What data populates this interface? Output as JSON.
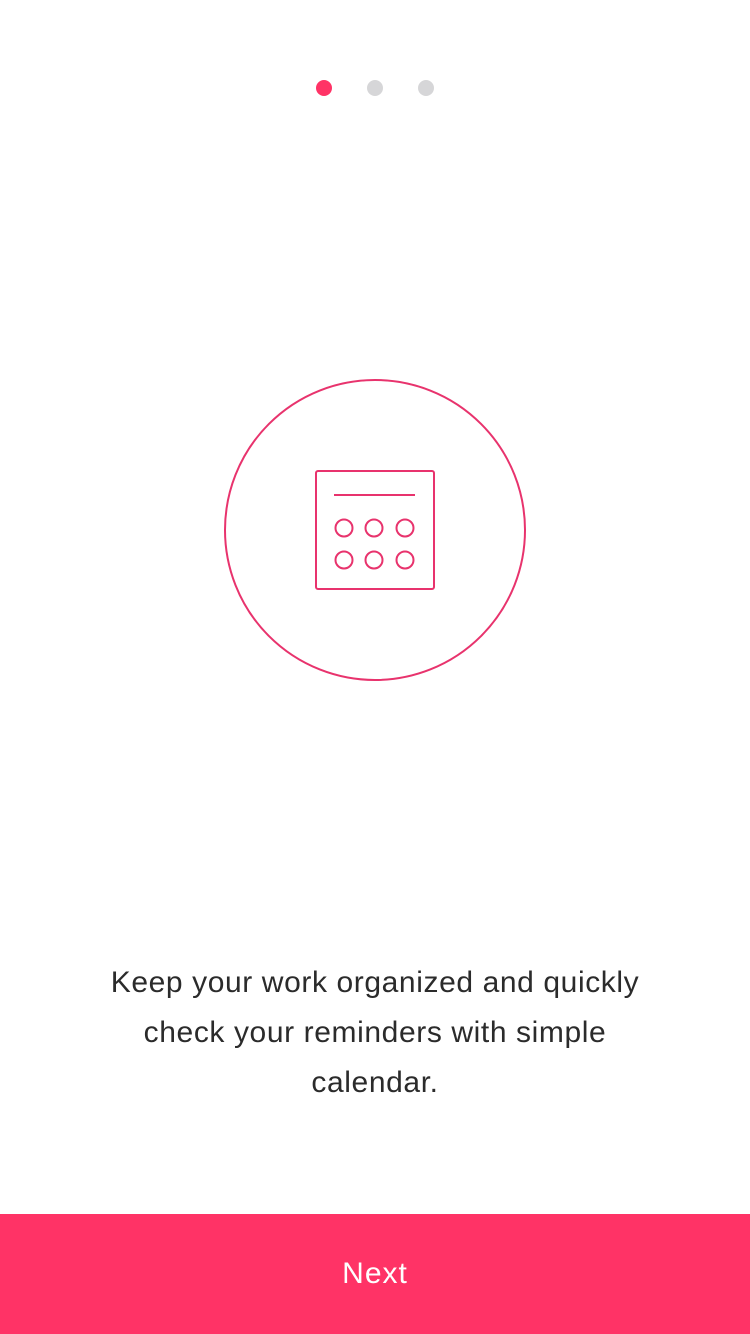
{
  "pager": {
    "total_pages": 3,
    "current_page": 1
  },
  "hero": {
    "icon": "calendar-icon"
  },
  "onboarding": {
    "description": "Keep your work organized and quickly check your reminders with simple calendar."
  },
  "actions": {
    "next_label": "Next"
  },
  "colors": {
    "accent": "#ff3366",
    "inactive_dot": "#d6d6d8",
    "text": "#2b2b2b",
    "background": "#ffffff"
  }
}
